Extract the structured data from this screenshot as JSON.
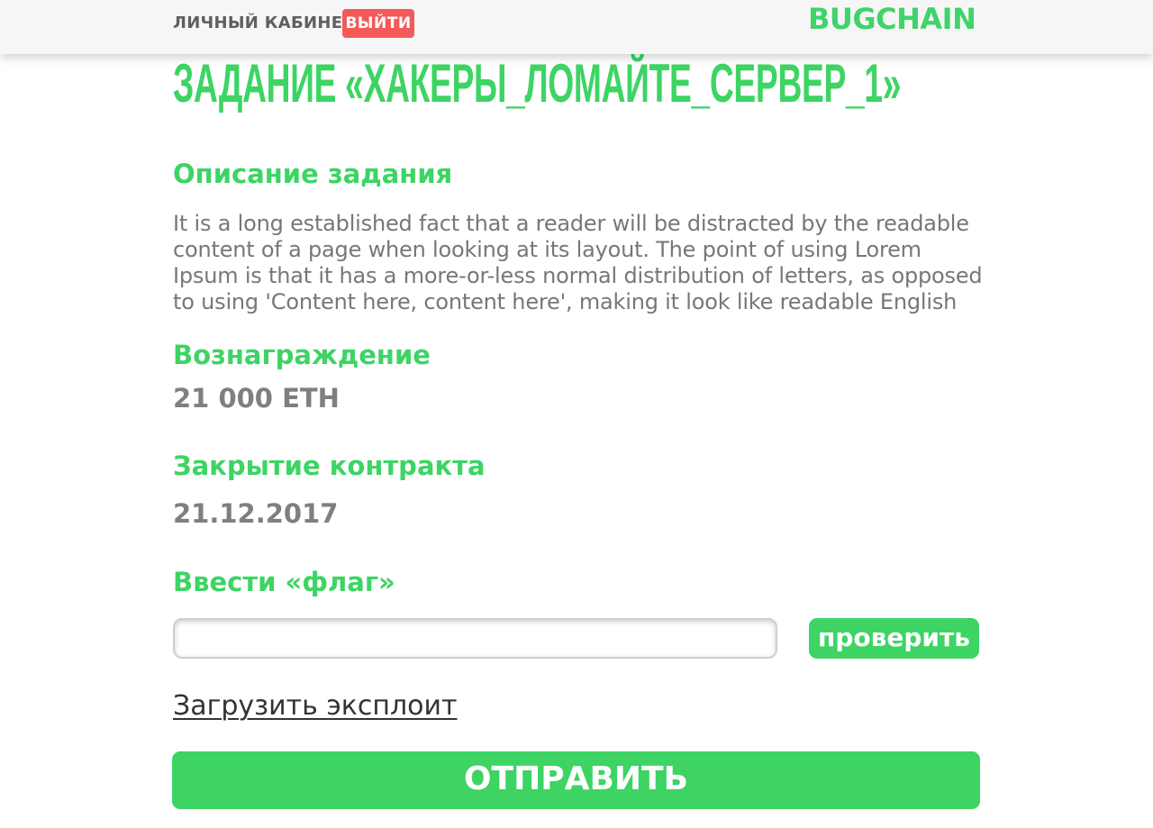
{
  "header": {
    "account_label": "ЛИЧНЫЙ КАБИНЕТ",
    "logout_label": "ВЫЙТИ",
    "logo_text": "BUGCHAIN"
  },
  "task": {
    "title": "ЗАДАНИЕ «ХАКЕРЫ_ЛОМАЙТЕ_СЕРВЕР_1»",
    "description_heading": "Описание задания",
    "description_text": "It is a long established fact that a reader will be distracted by the readable content of a page when looking at its layout. The point of using Lorem Ipsum is that it has a more-or-less normal distribution of letters, as opposed to using 'Content here, content here', making it look like readable English",
    "reward_heading": "Вознаграждение",
    "reward_value": "21 000 ETH",
    "close_heading": "Закрытие контракта",
    "close_value": "21.12.2017",
    "flag_heading": "Ввести «флаг»"
  },
  "form": {
    "flag_value": "",
    "flag_placeholder": "",
    "check_label": "проверить",
    "upload_label": "Загрузить эксплоит",
    "submit_label": "ОТПРАВИТЬ"
  },
  "colors": {
    "accent": "#3dd464",
    "danger": "#f45a5a",
    "muted_text": "#777777",
    "header_bg": "#f6f6f6"
  }
}
